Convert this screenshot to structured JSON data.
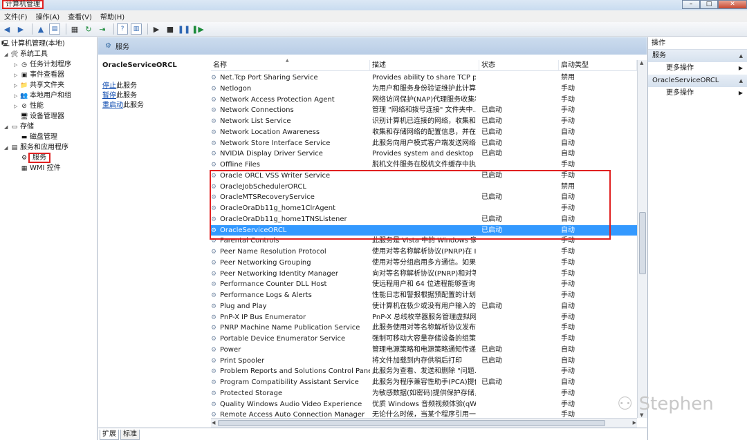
{
  "window": {
    "title": "计算机管理"
  },
  "menu": [
    "文件(F)",
    "操作(A)",
    "查看(V)",
    "帮助(H)"
  ],
  "tree": [
    {
      "label": "计算机管理(本地)",
      "level": 0,
      "icon": "computer-icon"
    },
    {
      "label": "系统工具",
      "level": 1,
      "icon": "tools-icon"
    },
    {
      "label": "任务计划程序",
      "level": 2,
      "icon": "clock-icon"
    },
    {
      "label": "事件查看器",
      "level": 2,
      "icon": "event-icon"
    },
    {
      "label": "共享文件夹",
      "level": 2,
      "icon": "folder-icon"
    },
    {
      "label": "本地用户和组",
      "level": 2,
      "icon": "users-icon"
    },
    {
      "label": "性能",
      "level": 2,
      "icon": "performance-icon"
    },
    {
      "label": "设备管理器",
      "level": 2,
      "icon": "device-icon"
    },
    {
      "label": "存储",
      "level": 1,
      "icon": "storage-icon"
    },
    {
      "label": "磁盘管理",
      "level": 2,
      "icon": "disk-icon"
    },
    {
      "label": "服务和应用程序",
      "level": 1,
      "icon": "apps-icon"
    },
    {
      "label": "服务",
      "level": 2,
      "icon": "gear-icon"
    },
    {
      "label": "WMI 控件",
      "level": 2,
      "icon": "wmi-icon"
    }
  ],
  "services_header": "服务",
  "detail": {
    "title": "OracleServiceORCL",
    "links": [
      {
        "link": "停止",
        "rest": "此服务"
      },
      {
        "link": "暂停",
        "rest": "此服务"
      },
      {
        "link": "重启动",
        "rest": "此服务"
      }
    ]
  },
  "columns": [
    "名称",
    "描述",
    "状态",
    "启动类型"
  ],
  "rows": [
    {
      "name": "Net.Tcp Port Sharing Service",
      "desc": "Provides ability to share TCP po...",
      "status": "",
      "startup": "禁用"
    },
    {
      "name": "Netlogon",
      "desc": "为用户和服务身份验证维护此计算...",
      "status": "",
      "startup": "手动"
    },
    {
      "name": "Network Access Protection Agent",
      "desc": "网络访问保护(NAP)代理服务收集和...",
      "status": "",
      "startup": "手动"
    },
    {
      "name": "Network Connections",
      "desc": "管理 \"网络和拨号连接\" 文件夹中...",
      "status": "已启动",
      "startup": "手动"
    },
    {
      "name": "Network List Service",
      "desc": "识别计算机已连接的网络，收集和...",
      "status": "已启动",
      "startup": "手动"
    },
    {
      "name": "Network Location Awareness",
      "desc": "收集和存储网络的配置信息，并在...",
      "status": "已启动",
      "startup": "自动"
    },
    {
      "name": "Network Store Interface Service",
      "desc": "此服务向用户模式客户端发送网络...",
      "status": "已启动",
      "startup": "自动"
    },
    {
      "name": "NVIDIA Display Driver Service",
      "desc": "Provides system and desktop le...",
      "status": "已启动",
      "startup": "自动"
    },
    {
      "name": "Offline Files",
      "desc": "脱机文件服务在脱机文件缓存中执...",
      "status": "",
      "startup": "手动"
    },
    {
      "name": "Oracle ORCL VSS Writer Service",
      "desc": "",
      "status": "已启动",
      "startup": "手动"
    },
    {
      "name": "OracleJobSchedulerORCL",
      "desc": "",
      "status": "",
      "startup": "禁用"
    },
    {
      "name": "OracleMTSRecoveryService",
      "desc": "",
      "status": "已启动",
      "startup": "自动"
    },
    {
      "name": "OracleOraDb11g_home1ClrAgent",
      "desc": "",
      "status": "",
      "startup": "手动"
    },
    {
      "name": "OracleOraDb11g_home1TNSListener",
      "desc": "",
      "status": "已启动",
      "startup": "自动"
    },
    {
      "name": "OracleServiceORCL",
      "desc": "",
      "status": "已启动",
      "startup": "自动",
      "selected": true
    },
    {
      "name": "Parental Controls",
      "desc": "此服务是 Vista 中的 Windows 家...",
      "status": "",
      "startup": "手动"
    },
    {
      "name": "Peer Name Resolution Protocol",
      "desc": "使用对等名称解析协议(PNRP)在 In...",
      "status": "",
      "startup": "手动"
    },
    {
      "name": "Peer Networking Grouping",
      "desc": "使用对等分组启用多方通信。如果...",
      "status": "",
      "startup": "手动"
    },
    {
      "name": "Peer Networking Identity Manager",
      "desc": "向对等名称解析协议(PNRP)和对等...",
      "status": "",
      "startup": "手动"
    },
    {
      "name": "Performance Counter DLL Host",
      "desc": "使远程用户和 64 位进程能够查询 3...",
      "status": "",
      "startup": "手动"
    },
    {
      "name": "Performance Logs & Alerts",
      "desc": "性能日志和警报根据预配置的计划...",
      "status": "",
      "startup": "手动"
    },
    {
      "name": "Plug and Play",
      "desc": "使计算机在极少或没有用户输入的...",
      "status": "已启动",
      "startup": "自动"
    },
    {
      "name": "PnP-X IP Bus Enumerator",
      "desc": "PnP-X 总线枚举器服务管理虚拟网...",
      "status": "",
      "startup": "手动"
    },
    {
      "name": "PNRP Machine Name Publication Service",
      "desc": "此服务使用对等名称解析协议发布...",
      "status": "",
      "startup": "手动"
    },
    {
      "name": "Portable Device Enumerator Service",
      "desc": "强制可移动大容量存储设备的组策...",
      "status": "",
      "startup": "手动"
    },
    {
      "name": "Power",
      "desc": "管理电源策略和电源策略通知传递。",
      "status": "已启动",
      "startup": "自动"
    },
    {
      "name": "Print Spooler",
      "desc": "将文件加载到内存供稍后打印",
      "status": "已启动",
      "startup": "自动"
    },
    {
      "name": "Problem Reports and Solutions Control Panel ...",
      "desc": "此服务为查看、发送和删除 \"问题...",
      "status": "",
      "startup": "手动"
    },
    {
      "name": "Program Compatibility Assistant Service",
      "desc": "此服务为程序兼容性助手(PCA)提供...",
      "status": "已启动",
      "startup": "自动"
    },
    {
      "name": "Protected Storage",
      "desc": "为敏感数据(如密码)提供保护存储，...",
      "status": "",
      "startup": "手动"
    },
    {
      "name": "Quality Windows Audio Video Experience",
      "desc": "优质 Windows 音频视频体验(qWa...",
      "status": "",
      "startup": "手动"
    },
    {
      "name": "Remote Access Auto Connection Manager",
      "desc": "无论什么时候，当某个程序引用一...",
      "status": "",
      "startup": "手动"
    }
  ],
  "tabs": [
    "扩展",
    "标准"
  ],
  "actions": {
    "title": "操作",
    "groups": [
      {
        "label": "服务",
        "item": "更多操作"
      },
      {
        "label": "OracleServiceORCL",
        "item": "更多操作"
      }
    ]
  },
  "watermark": "Stephen"
}
